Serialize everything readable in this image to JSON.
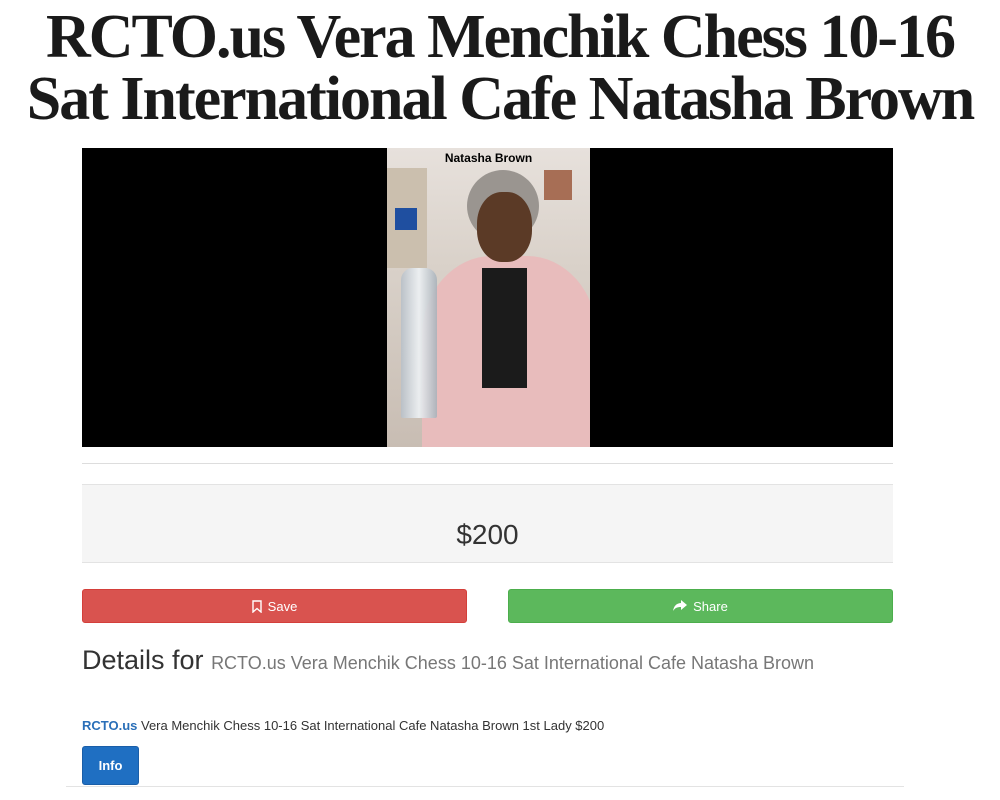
{
  "page": {
    "title": "RCTO.us Vera Menchik Chess 10-16 Sat International Cafe Natasha Brown"
  },
  "photo": {
    "caption": "Natasha Brown"
  },
  "price": "$200",
  "buttons": {
    "save_label": "Save",
    "save_icon": "bookmark-icon",
    "share_label": "Share",
    "share_icon": "share-arrow-icon",
    "info_label": "Info"
  },
  "details": {
    "heading": "Details for",
    "subheading": "RCTO.us Vera Menchik Chess 10-16 Sat International Cafe Natasha Brown"
  },
  "description": {
    "link_text": "RCTO.us",
    "text": " Vera Menchik Chess 10-16 Sat International Cafe Natasha Brown 1st Lady $200"
  },
  "colors": {
    "save": "#d9534f",
    "share": "#5cb85c",
    "info": "#1f6fc2",
    "link": "#2a6fb8"
  }
}
